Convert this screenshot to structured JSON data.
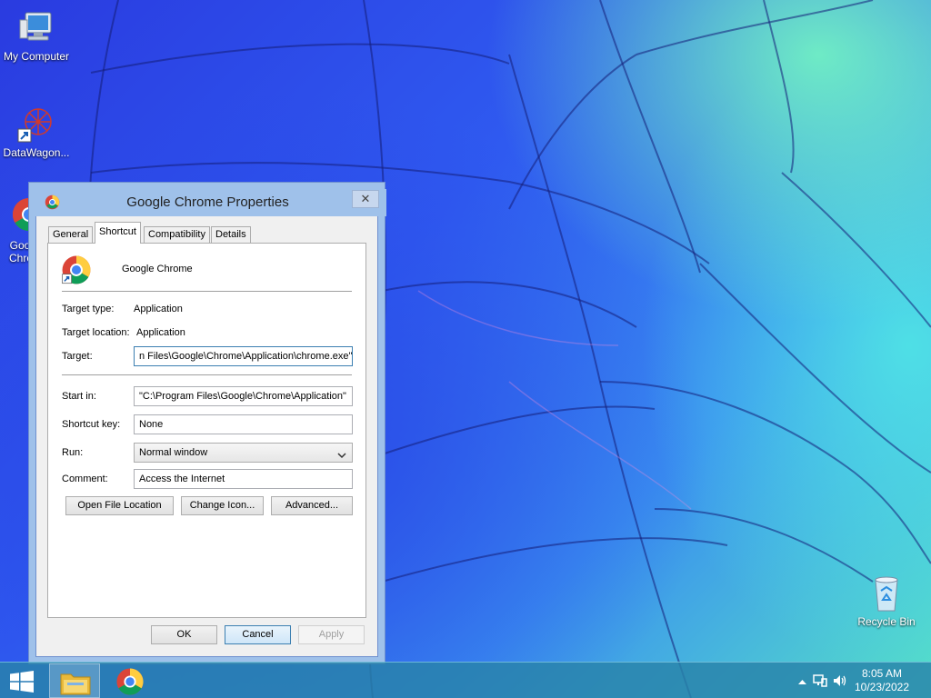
{
  "desktop": {
    "icons": [
      {
        "label": "My Computer"
      },
      {
        "label": "DataWagon..."
      },
      {
        "label": "Google Chrome"
      },
      {
        "label": "Recycle Bin"
      }
    ]
  },
  "dialog": {
    "title": "Google Chrome Properties",
    "close_label": "✕",
    "tabs": [
      {
        "label": "General"
      },
      {
        "label": "Shortcut",
        "active": true
      },
      {
        "label": "Compatibility"
      },
      {
        "label": "Details"
      }
    ],
    "app_name": "Google Chrome",
    "target_type_label": "Target type:",
    "target_type_value": "Application",
    "target_location_label": "Target location:",
    "target_location_value": "Application",
    "target_label": "Target:",
    "target_value": "n Files\\Google\\Chrome\\Application\\chrome.exe\"",
    "start_in_label": "Start in:",
    "start_in_value": "\"C:\\Program Files\\Google\\Chrome\\Application\"",
    "shortcut_key_label": "Shortcut key:",
    "shortcut_key_value": "None",
    "run_label": "Run:",
    "run_value": "Normal window",
    "comment_label": "Comment:",
    "comment_value": "Access the Internet",
    "buttons": {
      "open_file_location": "Open File Location",
      "change_icon": "Change Icon...",
      "advanced": "Advanced..."
    },
    "footer": {
      "ok": "OK",
      "cancel": "Cancel",
      "apply": "Apply"
    }
  },
  "taskbar": {
    "clock_time": "8:05 AM",
    "clock_date": "10/23/2022"
  },
  "colors": {
    "title_bar": "#9fc1ea",
    "taskbar": "#2882aa",
    "focus_border": "#3c7fb1"
  }
}
